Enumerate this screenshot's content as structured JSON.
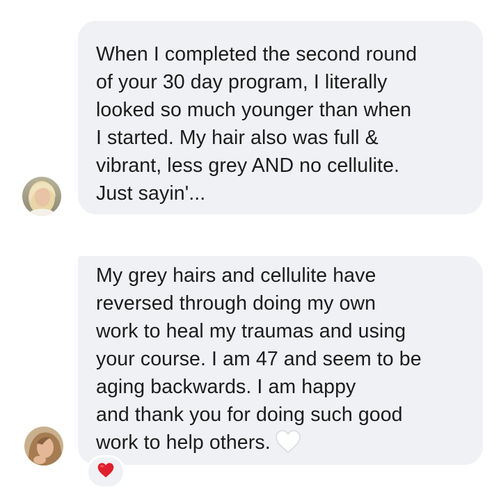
{
  "messages": [
    {
      "lines": [
        "When I completed the second round",
        "of your 30 day program, I literally",
        "looked so much younger than when",
        "I started. My hair also was full &",
        "vibrant, less grey AND no cellulite.",
        "Just sayin'..."
      ],
      "avatar_icon": "user-avatar-photo"
    },
    {
      "lines": [
        "My grey hairs and cellulite have",
        "reversed through doing my own",
        "work to heal my traumas and using",
        "your course. I am 47 and seem to be",
        "aging backwards. I am happy",
        "and thank you for doing such good",
        "work to help others."
      ],
      "inline_emoji": "white-heart-icon",
      "avatar_icon": "user-avatar-photo",
      "reaction_icon": "red-heart-icon"
    }
  ],
  "colors": {
    "bubble": "#f0f1f4",
    "text": "#1b1b1b",
    "reaction_heart": "#e0202c",
    "white_heart": "#ffffff"
  }
}
